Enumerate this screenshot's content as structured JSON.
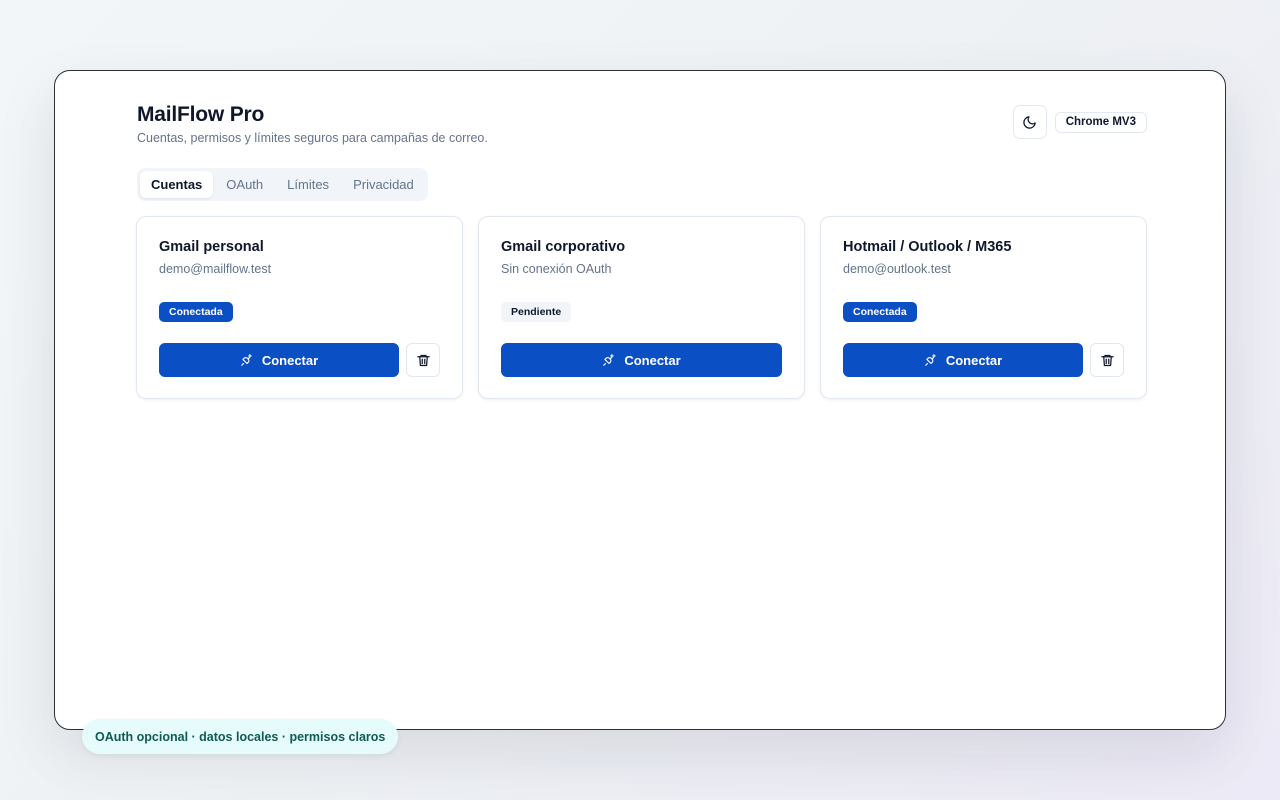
{
  "app": {
    "title": "MailFlow Pro",
    "subtitle": "Cuentas, permisos y límites seguros para campañas de correo.",
    "platform_badge": "Chrome MV3",
    "theme_icon": "moon-icon"
  },
  "tabs": [
    {
      "label": "Cuentas",
      "active": true
    },
    {
      "label": "OAuth",
      "active": false
    },
    {
      "label": "Límites",
      "active": false
    },
    {
      "label": "Privacidad",
      "active": false
    }
  ],
  "cards": [
    {
      "title": "Gmail personal",
      "email": "demo@mailflow.test",
      "status": "Conectada",
      "status_type": "connected",
      "action_label": "Conectar",
      "deletable": true
    },
    {
      "title": "Gmail corporativo",
      "email": "Sin conexión OAuth",
      "status": "Pendiente",
      "status_type": "pending",
      "action_label": "Conectar",
      "deletable": false
    },
    {
      "title": "Hotmail / Outlook / M365",
      "email": "demo@outlook.test",
      "status": "Conectada",
      "status_type": "connected",
      "action_label": "Conectar",
      "deletable": true
    }
  ],
  "footer": {
    "pill_text": "OAuth opcional · datos locales · permisos claros"
  },
  "colors": {
    "primary": "#0b4fc4",
    "footer_bg": "#e6fbfb",
    "footer_text": "#0f5a54"
  }
}
